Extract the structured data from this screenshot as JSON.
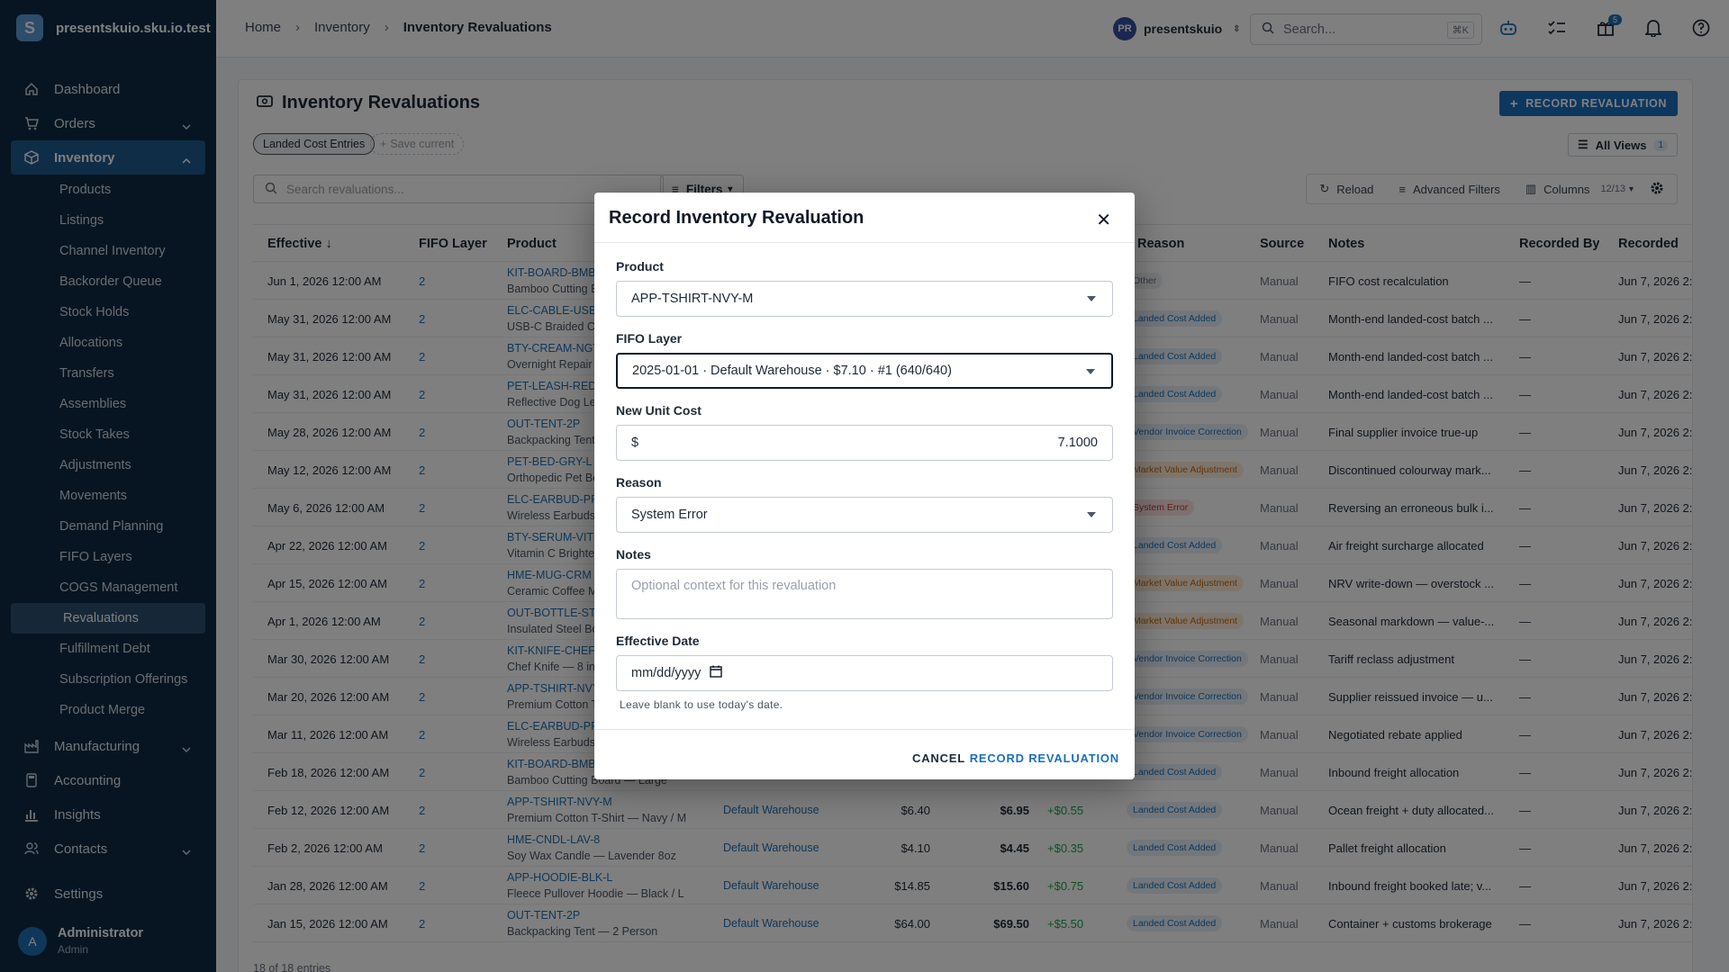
{
  "app": {
    "name": "presentskuio.sku.io.test"
  },
  "sidebar": {
    "items": [
      {
        "label": "Dashboard"
      },
      {
        "label": "Orders"
      },
      {
        "label": "Inventory"
      },
      {
        "label": "Manufacturing"
      },
      {
        "label": "Accounting"
      },
      {
        "label": "Insights"
      },
      {
        "label": "Contacts"
      },
      {
        "label": "Settings"
      }
    ],
    "inventory_sub": [
      "Products",
      "Listings",
      "Channel Inventory",
      "Backorder Queue",
      "Stock Holds",
      "Allocations",
      "Transfers",
      "Assemblies",
      "Stock Takes",
      "Adjustments",
      "Movements",
      "Demand Planning",
      "FIFO Layers",
      "COGS Management",
      "Revaluations",
      "Fulfillment Debt",
      "Subscription Offerings",
      "Product Merge"
    ],
    "user": {
      "initial": "A",
      "name": "Administrator",
      "role": "Admin"
    }
  },
  "topbar": {
    "breadcrumbs": [
      "Home",
      "Inventory",
      "Inventory Revaluations"
    ],
    "account": {
      "initials": "PR",
      "name": "presentskuio"
    },
    "search": {
      "placeholder": "Search...",
      "shortcut": "⌘K"
    },
    "gift_badge": "5"
  },
  "page": {
    "title": "Inventory Revaluations",
    "record_button": "RECORD REVALUATION",
    "chips": {
      "view": "Landed Cost Entries",
      "save": "Save current"
    },
    "all_views": {
      "label": "All Views",
      "count": "1"
    },
    "search_placeholder": "Search revaluations...",
    "filters_label": "Filters",
    "tools": {
      "reload": "Reload",
      "advanced": "Advanced Filters",
      "columns": "Columns",
      "columns_count": "12/13"
    },
    "footer": "18 of 18 entries"
  },
  "table": {
    "columns": [
      "Effective",
      "FIFO Layer",
      "Product",
      "Reason",
      "Source",
      "Notes",
      "Recorded By",
      "Recorded"
    ],
    "rows": [
      {
        "effective": "Jun 1, 2026 12:00 AM",
        "layer": "2",
        "sku": "KIT-BOARD-BMB",
        "name": "Bamboo Cutting Board — Large",
        "warehouse": "",
        "old": "",
        "new": "",
        "delta": "",
        "reason": "Other",
        "reason_kind": "gray",
        "source": "Manual",
        "notes": "FIFO cost recalculation",
        "by": "—",
        "recorded": "Jun 7, 2026 2:"
      },
      {
        "effective": "May 31, 2026 12:00 AM",
        "layer": "2",
        "sku": "ELC-CABLE-USBC",
        "name": "USB-C Braided Cable",
        "warehouse": "",
        "old": "",
        "new": "",
        "delta": "",
        "reason": "Landed Cost Added",
        "reason_kind": "blue",
        "source": "Manual",
        "notes": "Month-end landed-cost batch ...",
        "by": "—",
        "recorded": "Jun 7, 2026 2:"
      },
      {
        "effective": "May 31, 2026 12:00 AM",
        "layer": "2",
        "sku": "BTY-CREAM-NGT",
        "name": "Overnight Repair Cream",
        "warehouse": "",
        "old": "",
        "new": "",
        "delta": "",
        "reason": "Landed Cost Added",
        "reason_kind": "blue",
        "source": "Manual",
        "notes": "Month-end landed-cost batch ...",
        "by": "—",
        "recorded": "Jun 7, 2026 2:"
      },
      {
        "effective": "May 31, 2026 12:00 AM",
        "layer": "2",
        "sku": "PET-LEASH-RED",
        "name": "Reflective Dog Leash",
        "warehouse": "",
        "old": "",
        "new": "",
        "delta": "",
        "reason": "Landed Cost Added",
        "reason_kind": "blue",
        "source": "Manual",
        "notes": "Month-end landed-cost batch ...",
        "by": "—",
        "recorded": "Jun 7, 2026 2:"
      },
      {
        "effective": "May 28, 2026 12:00 AM",
        "layer": "2",
        "sku": "OUT-TENT-2P",
        "name": "Backpacking Tent — 2 Person",
        "warehouse": "",
        "old": "",
        "new": "",
        "delta": "",
        "reason": "Vendor Invoice Correction",
        "reason_kind": "blue",
        "source": "Manual",
        "notes": "Final supplier invoice true-up",
        "by": "—",
        "recorded": "Jun 7, 2026 2:"
      },
      {
        "effective": "May 12, 2026 12:00 AM",
        "layer": "2",
        "sku": "PET-BED-GRY-L",
        "name": "Orthopedic Pet Bed",
        "warehouse": "",
        "old": "",
        "new": "",
        "delta": "",
        "reason": "Market Value Adjustment",
        "reason_kind": "orange",
        "source": "Manual",
        "notes": "Discontinued colourway mark...",
        "by": "—",
        "recorded": "Jun 7, 2026 2:"
      },
      {
        "effective": "May 6, 2026 12:00 AM",
        "layer": "2",
        "sku": "ELC-EARBUD-PRO",
        "name": "Wireless Earbuds Pro",
        "warehouse": "",
        "old": "",
        "new": "",
        "delta": "",
        "reason": "System Error",
        "reason_kind": "red",
        "source": "Manual",
        "notes": "Reversing an erroneous bulk i...",
        "by": "—",
        "recorded": "Jun 7, 2026 2:"
      },
      {
        "effective": "Apr 22, 2026 12:00 AM",
        "layer": "2",
        "sku": "BTY-SERUM-VITC",
        "name": "Vitamin C Brightening Serum",
        "warehouse": "",
        "old": "",
        "new": "",
        "delta": "",
        "reason": "Landed Cost Added",
        "reason_kind": "blue",
        "source": "Manual",
        "notes": "Air freight surcharge allocated",
        "by": "—",
        "recorded": "Jun 7, 2026 2:"
      },
      {
        "effective": "Apr 15, 2026 12:00 AM",
        "layer": "2",
        "sku": "HME-MUG-CRM",
        "name": "Ceramic Coffee Mug",
        "warehouse": "",
        "old": "",
        "new": "",
        "delta": "",
        "reason": "Market Value Adjustment",
        "reason_kind": "orange",
        "source": "Manual",
        "notes": "NRV write-down — overstock ...",
        "by": "—",
        "recorded": "Jun 7, 2026 2:"
      },
      {
        "effective": "Apr 1, 2026 12:00 AM",
        "layer": "2",
        "sku": "OUT-BOTTLE-STL",
        "name": "Insulated Steel Bottle",
        "warehouse": "",
        "old": "",
        "new": "",
        "delta": "",
        "reason": "Market Value Adjustment",
        "reason_kind": "orange",
        "source": "Manual",
        "notes": "Seasonal markdown — value-...",
        "by": "—",
        "recorded": "Jun 7, 2026 2:"
      },
      {
        "effective": "Mar 30, 2026 12:00 AM",
        "layer": "2",
        "sku": "KIT-KNIFE-CHEF",
        "name": "Chef Knife — 8 in",
        "warehouse": "",
        "old": "",
        "new": "",
        "delta": "",
        "reason": "Vendor Invoice Correction",
        "reason_kind": "blue",
        "source": "Manual",
        "notes": "Tariff reclass adjustment",
        "by": "—",
        "recorded": "Jun 7, 2026 2:"
      },
      {
        "effective": "Mar 20, 2026 12:00 AM",
        "layer": "2",
        "sku": "APP-TSHIRT-NVY",
        "name": "Premium Cotton T-Shirt",
        "warehouse": "",
        "old": "",
        "new": "",
        "delta": "",
        "reason": "Vendor Invoice Correction",
        "reason_kind": "blue",
        "source": "Manual",
        "notes": "Supplier reissued invoice — u...",
        "by": "—",
        "recorded": "Jun 7, 2026 2:"
      },
      {
        "effective": "Mar 11, 2026 12:00 AM",
        "layer": "2",
        "sku": "ELC-EARBUD-PRO",
        "name": "Wireless Earbuds Pro",
        "warehouse": "",
        "old": "",
        "new": "",
        "delta": "",
        "reason": "Vendor Invoice Correction",
        "reason_kind": "blue",
        "source": "Manual",
        "notes": "Negotiated rebate applied",
        "by": "—",
        "recorded": "Jun 7, 2026 2:"
      },
      {
        "effective": "Feb 18, 2026 12:00 AM",
        "layer": "2",
        "sku": "KIT-BOARD-BMB",
        "name": "Bamboo Cutting Board — Large",
        "warehouse": "",
        "old": "",
        "new": "",
        "delta": "",
        "reason": "Landed Cost Added",
        "reason_kind": "blue",
        "source": "Manual",
        "notes": "Inbound freight allocation",
        "by": "—",
        "recorded": "Jun 7, 2026 2:"
      },
      {
        "effective": "Feb 12, 2026 12:00 AM",
        "layer": "2",
        "sku": "APP-TSHIRT-NVY-M",
        "name": "Premium Cotton T-Shirt — Navy / M",
        "warehouse": "Default Warehouse",
        "old": "$6.40",
        "new": "$6.95",
        "delta": "+$0.55",
        "reason": "Landed Cost Added",
        "reason_kind": "blue",
        "source": "Manual",
        "notes": "Ocean freight + duty allocated...",
        "by": "—",
        "recorded": "Jun 7, 2026 2:"
      },
      {
        "effective": "Feb 2, 2026 12:00 AM",
        "layer": "2",
        "sku": "HME-CNDL-LAV-8",
        "name": "Soy Wax Candle — Lavender 8oz",
        "warehouse": "Default Warehouse",
        "old": "$4.10",
        "new": "$4.45",
        "delta": "+$0.35",
        "reason": "Landed Cost Added",
        "reason_kind": "blue",
        "source": "Manual",
        "notes": "Pallet freight allocation",
        "by": "—",
        "recorded": "Jun 7, 2026 2:"
      },
      {
        "effective": "Jan 28, 2026 12:00 AM",
        "layer": "2",
        "sku": "APP-HOODIE-BLK-L",
        "name": "Fleece Pullover Hoodie — Black / L",
        "warehouse": "Default Warehouse",
        "old": "$14.85",
        "new": "$15.60",
        "delta": "+$0.75",
        "reason": "Landed Cost Added",
        "reason_kind": "blue",
        "source": "Manual",
        "notes": "Inbound freight booked late; v...",
        "by": "—",
        "recorded": "Jun 7, 2026 2:"
      },
      {
        "effective": "Jan 15, 2026 12:00 AM",
        "layer": "2",
        "sku": "OUT-TENT-2P",
        "name": "Backpacking Tent — 2 Person",
        "warehouse": "Default Warehouse",
        "old": "$64.00",
        "new": "$69.50",
        "delta": "+$5.50",
        "reason": "Landed Cost Added",
        "reason_kind": "blue",
        "source": "Manual",
        "notes": "Container + customs brokerage",
        "by": "—",
        "recorded": "Jun 7, 2026 2:"
      }
    ]
  },
  "modal": {
    "title": "Record Inventory Revaluation",
    "product": {
      "label": "Product",
      "value": "APP-TSHIRT-NVY-M"
    },
    "fifo_layer": {
      "label": "FIFO Layer",
      "value": "2025-01-01 · Default Warehouse · $7.10 · #1 (640/640)"
    },
    "unit_cost": {
      "label": "New Unit Cost",
      "prefix": "$",
      "value": "7.1000"
    },
    "reason": {
      "label": "Reason",
      "value": "System Error"
    },
    "notes": {
      "label": "Notes",
      "placeholder": "Optional context for this revaluation"
    },
    "effective_date": {
      "label": "Effective Date",
      "placeholder": "mm/dd/yyyy",
      "hint": "Leave blank to use today's date."
    },
    "cancel": "CANCEL",
    "submit": "RECORD REVALUATION"
  },
  "colors": {
    "accent": "#1b6fbf",
    "sidebar": "#0f2a44",
    "link": "#1f6fb2",
    "success": "#16a34a"
  }
}
